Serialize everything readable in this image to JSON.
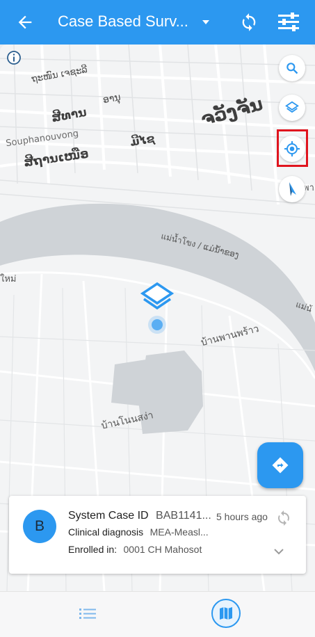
{
  "appbar": {
    "title": "Case Based Surv...",
    "icons": [
      "back-arrow-icon",
      "dropdown-caret-icon",
      "sync-icon",
      "filter-icon"
    ]
  },
  "map": {
    "labels": {
      "lao_top": "ຖະໜົນ ເຈຊະລີ",
      "lao_mid": "ອານຸ",
      "lao_big": "ຈວັງຈັນ",
      "lao_sethathirat": "ສີທານ",
      "souphanouvong": "Souphanouvong",
      "lao_street": "ສີຖານເໜືອ",
      "lao_mixay": "ມີໄຊ",
      "mekong": "แม่น้ำโขง / ແມ່ນ້ຳຂອງ",
      "mekong_right": "แม่น้",
      "ban_phan_phrao": "บ้านพานพร้าว",
      "ban_non_sang": "บ้านโนนสง่า",
      "lao_left": "ใหม่",
      "pa_right": "พา"
    },
    "icons": [
      "info-icon",
      "search-icon",
      "layers-icon",
      "my-location-icon",
      "compass-icon",
      "directions-icon",
      "cluster-layers-icon"
    ]
  },
  "card": {
    "avatar_letter": "B",
    "case_id_label": "System Case ID",
    "case_id_value": "BAB1141...",
    "time": "5 hours ago",
    "diagnosis_label": "Clinical diagnosis",
    "diagnosis_value": "MEA-Measl...",
    "enrolled_label": "Enrolled in:",
    "enrolled_value": "0001 CH Mahosot"
  },
  "bottom_nav": {
    "items": [
      "list-view-icon",
      "map-view-icon"
    ],
    "active": "map-view-icon"
  },
  "colors": {
    "primary": "#2c98f0",
    "highlight": "#e0141e",
    "river": "#cfd3d7"
  }
}
